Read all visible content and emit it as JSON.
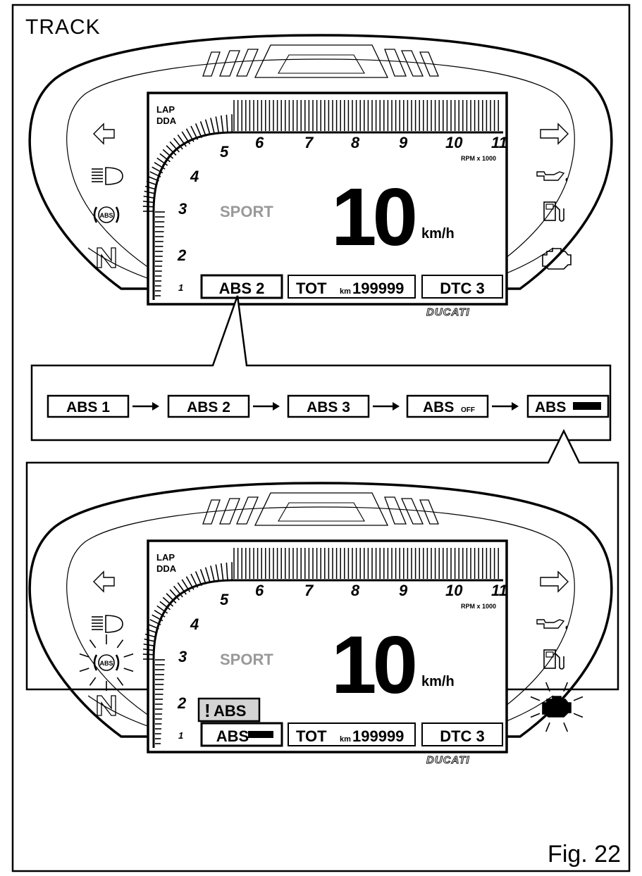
{
  "page": {
    "title": "TRACK",
    "figure_label": "Fig. 22"
  },
  "dashboard": {
    "lap_label": "LAP",
    "dda_label": "DDA",
    "rpm_ticks": [
      "1",
      "2",
      "3",
      "4",
      "5",
      "6",
      "7",
      "8",
      "9",
      "10",
      "11"
    ],
    "rpm_unit": "RPM x 1000",
    "mode": "SPORT",
    "speed": "10",
    "speed_unit": "km/h",
    "odometer_label": "TOT",
    "odometer_unit": "km",
    "odometer_value": "199999",
    "dtc_label": "DTC 3",
    "brand": "DUCATI"
  },
  "top_display": {
    "abs_box": "ABS 2"
  },
  "sequence": {
    "steps": [
      {
        "label": "ABS 1",
        "suffix": ""
      },
      {
        "label": "ABS 2",
        "suffix": ""
      },
      {
        "label": "ABS 3",
        "suffix": ""
      },
      {
        "label": "ABS",
        "suffix": "OFF"
      },
      {
        "label": "ABS",
        "suffix": ""
      }
    ]
  },
  "bottom_display": {
    "abs_box": "ABS",
    "warning_mark": "!",
    "warning_text": "ABS"
  },
  "icons": {
    "left": [
      "turn-left-arrow-icon",
      "high-beam-icon",
      "abs-warning-icon",
      "neutral-icon"
    ],
    "right": [
      "turn-right-arrow-icon",
      "oil-pressure-icon",
      "fuel-reserve-icon",
      "engine-check-icon"
    ]
  },
  "colors": {
    "ink": "#000000",
    "sport_text": "#999999",
    "warning_fill": "#d4d4d4"
  }
}
